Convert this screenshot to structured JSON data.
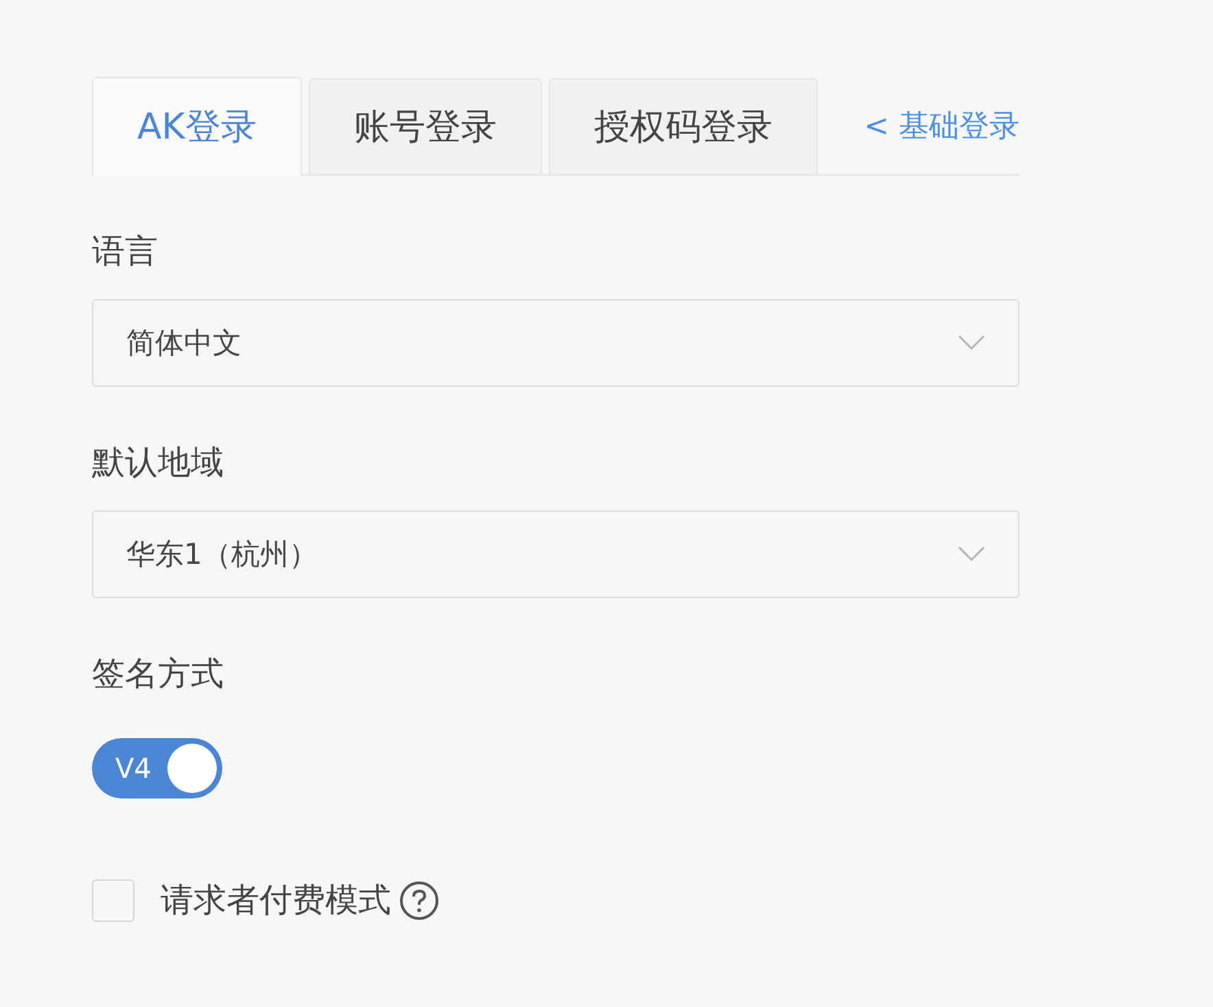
{
  "tabs": [
    {
      "label": "AK登录",
      "selected": true
    },
    {
      "label": "账号登录",
      "selected": false
    },
    {
      "label": "授权码登录",
      "selected": false
    }
  ],
  "basic_login_link": "< 基础登录",
  "fields": [
    {
      "kind": "select",
      "label": "语言",
      "value": "简体中文"
    },
    {
      "kind": "select",
      "label": "默认地域",
      "value": "华东1（杭州）"
    },
    {
      "kind": "toggle",
      "label": "签名方式",
      "toggle_label": "V4",
      "on": true
    }
  ],
  "requester_pays": {
    "label": "请求者付费模式",
    "checked": false
  }
}
